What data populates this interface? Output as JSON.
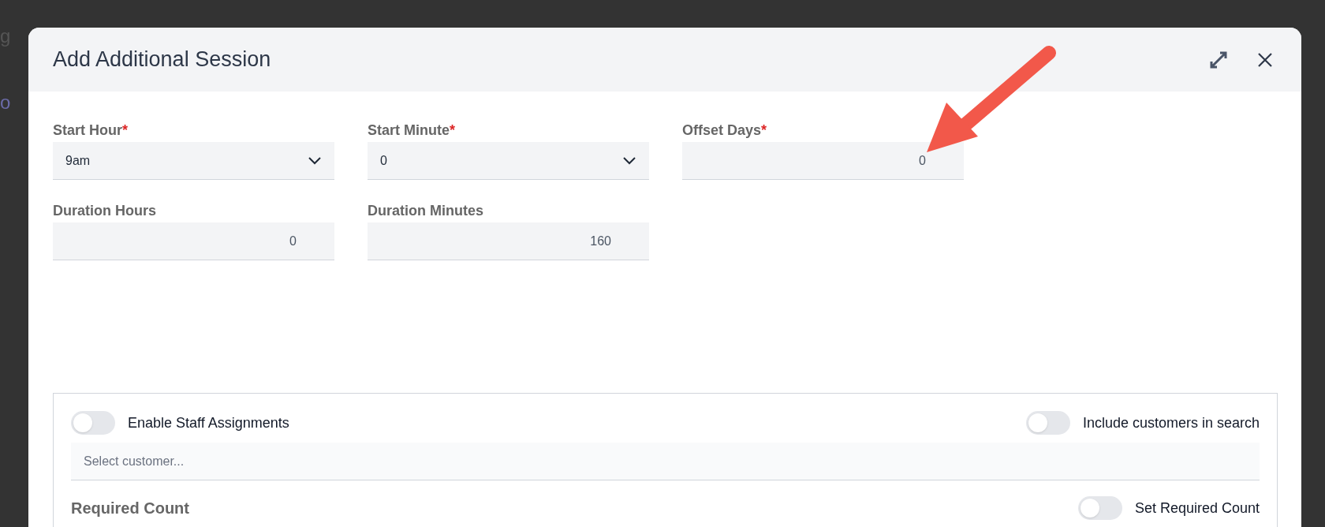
{
  "backdrop": {
    "texts": [
      "g",
      "o"
    ]
  },
  "dialog": {
    "title": "Add Additional Session",
    "fields": [
      {
        "label": "Start Hour",
        "required_mark": "*",
        "kind": "select",
        "value": "9am"
      },
      {
        "label": "Start Minute",
        "required_mark": "*",
        "kind": "select",
        "value": "0"
      },
      {
        "label": "Offset Days",
        "required_mark": "*",
        "kind": "number",
        "value": "0"
      },
      {
        "label": "Duration Hours",
        "kind": "number",
        "value": "0"
      },
      {
        "label": "Duration Minutes",
        "kind": "number",
        "value": "160"
      }
    ],
    "staff_panel": {
      "toggles": [
        {
          "label": "Enable Staff Assignments",
          "on": false
        },
        {
          "label": "Include customers in search",
          "on": false
        }
      ],
      "customer_select": {
        "placeholder": "Select customer..."
      },
      "required_count": {
        "label": "Required Count",
        "toggle": {
          "label": "Set Required Count",
          "on": false
        }
      }
    }
  }
}
